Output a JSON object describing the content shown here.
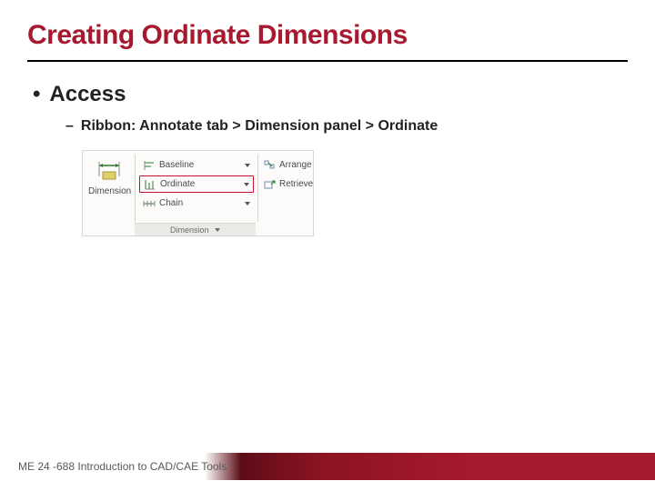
{
  "title": "Creating Ordinate Dimensions",
  "bullet1": "Access",
  "bullet2": "Ribbon: Annotate tab > Dimension panel > Ordinate",
  "ribbon": {
    "big_button": "Dimension",
    "rows": {
      "baseline": "Baseline",
      "ordinate": "Ordinate",
      "chain": "Chain"
    },
    "right": {
      "arrange": "Arrange",
      "retrieve": "Retrieve"
    },
    "panel": "Dimension"
  },
  "footer": "ME 24 -688 Introduction to CAD/CAE Tools"
}
